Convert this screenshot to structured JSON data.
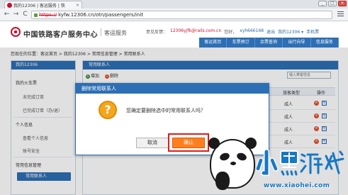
{
  "browser": {
    "tab_title": "我的12306 | 客运服务 | 铁",
    "tab_close": "×",
    "url_scheme": "https://",
    "url_rest": "kyfw.12306.cn/otn/passengers/init",
    "window_buttons": [
      "_",
      "□",
      "×"
    ],
    "nav": {
      "back": "←",
      "forward": "→",
      "reload": "C"
    }
  },
  "header": {
    "site_name": "中国铁路客户服务中心",
    "site_sub": "客运服务",
    "user_bar": {
      "welcome_label": "意见反馈：",
      "email": "12306yjfk@rails.com.cn",
      "hello_label": "您好，",
      "username": "xyh666168",
      "logout": "退出",
      "my12306": "我的12306 ▾",
      "mobile": "手机票"
    },
    "nav_items": [
      "客运首页",
      "车票预订",
      "余票查询",
      "出行向导",
      "信息服务"
    ]
  },
  "breadcrumb": "您现在的位置：客运首页 > 我的12306 > 常用信息管理 > 常用联系人",
  "sidebar": {
    "head": "我的12306",
    "group_train": "我的火车票",
    "unfinished_orders": "未完成订单",
    "finished_orders": "已完成订单（办/退）",
    "group_personal": "个人信息",
    "view_personal": "查看个人信息",
    "account_security": "账号安全",
    "group_common": "常用信息管理",
    "common_contacts": "常用联系人"
  },
  "panel": {
    "head": "常用联系人",
    "add_label": "增加",
    "delete_label": "删除",
    "search_placeholder": "输入乘客姓名",
    "col_type": "旅客类型",
    "col_op": "操作",
    "rows": [
      {
        "type": "成人"
      },
      {
        "type": "成人"
      },
      {
        "type": "成人"
      },
      {
        "type": "成人"
      }
    ]
  },
  "dialog": {
    "title": "删除常用联系人",
    "icon": "?",
    "message": "您确定要删除选中的常用联系人吗？",
    "cancel": "取消",
    "confirm": "确认"
  },
  "watermark": {
    "logo_text": "小黑游戏",
    "url": "www.xiaohei.com"
  },
  "colors": {
    "primary_blue": "#2d6fb4",
    "confirm_orange": "#ff7e1f",
    "highlight_red": "#e11b1b",
    "brand_red": "#c8102e"
  }
}
